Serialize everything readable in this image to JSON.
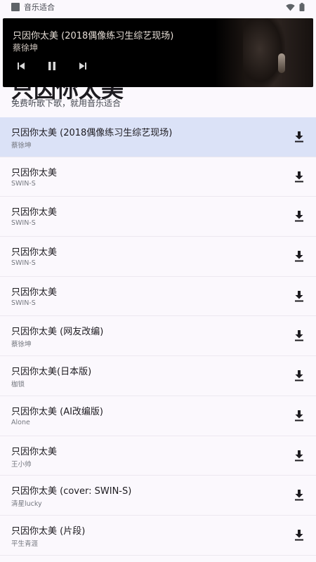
{
  "status": {
    "app_name": "音乐适合"
  },
  "player": {
    "title": "只因你太美 (2018偶像练习生综艺现场)",
    "artist": "蔡徐坤"
  },
  "header": {
    "title": "只因你太美",
    "subtitle": "免费听歌下歌，就用音乐适合"
  },
  "songs": [
    {
      "title": "只因你太美 (2018偶像练习生综艺现场)",
      "artist": "蔡徐坤"
    },
    {
      "title": "只因你太美",
      "artist": "SWIN-S"
    },
    {
      "title": "只因你太美",
      "artist": "SWIN-S"
    },
    {
      "title": "只因你太美",
      "artist": "SWIN-S"
    },
    {
      "title": "只因你太美",
      "artist": "SWIN-S"
    },
    {
      "title": "只因你太美 (网友改编)",
      "artist": "蔡徐坤"
    },
    {
      "title": "只因你太美(日本版)",
      "artist": "枷锁"
    },
    {
      "title": "只因你太美 (AI改编版)",
      "artist": "Alone"
    },
    {
      "title": "只因你太美",
      "artist": "王小帅"
    },
    {
      "title": "只因你太美 (cover: SWIN-S)",
      "artist": "清星lucky"
    },
    {
      "title": "只因你太美 (片段)",
      "artist": "平生青涯"
    }
  ]
}
